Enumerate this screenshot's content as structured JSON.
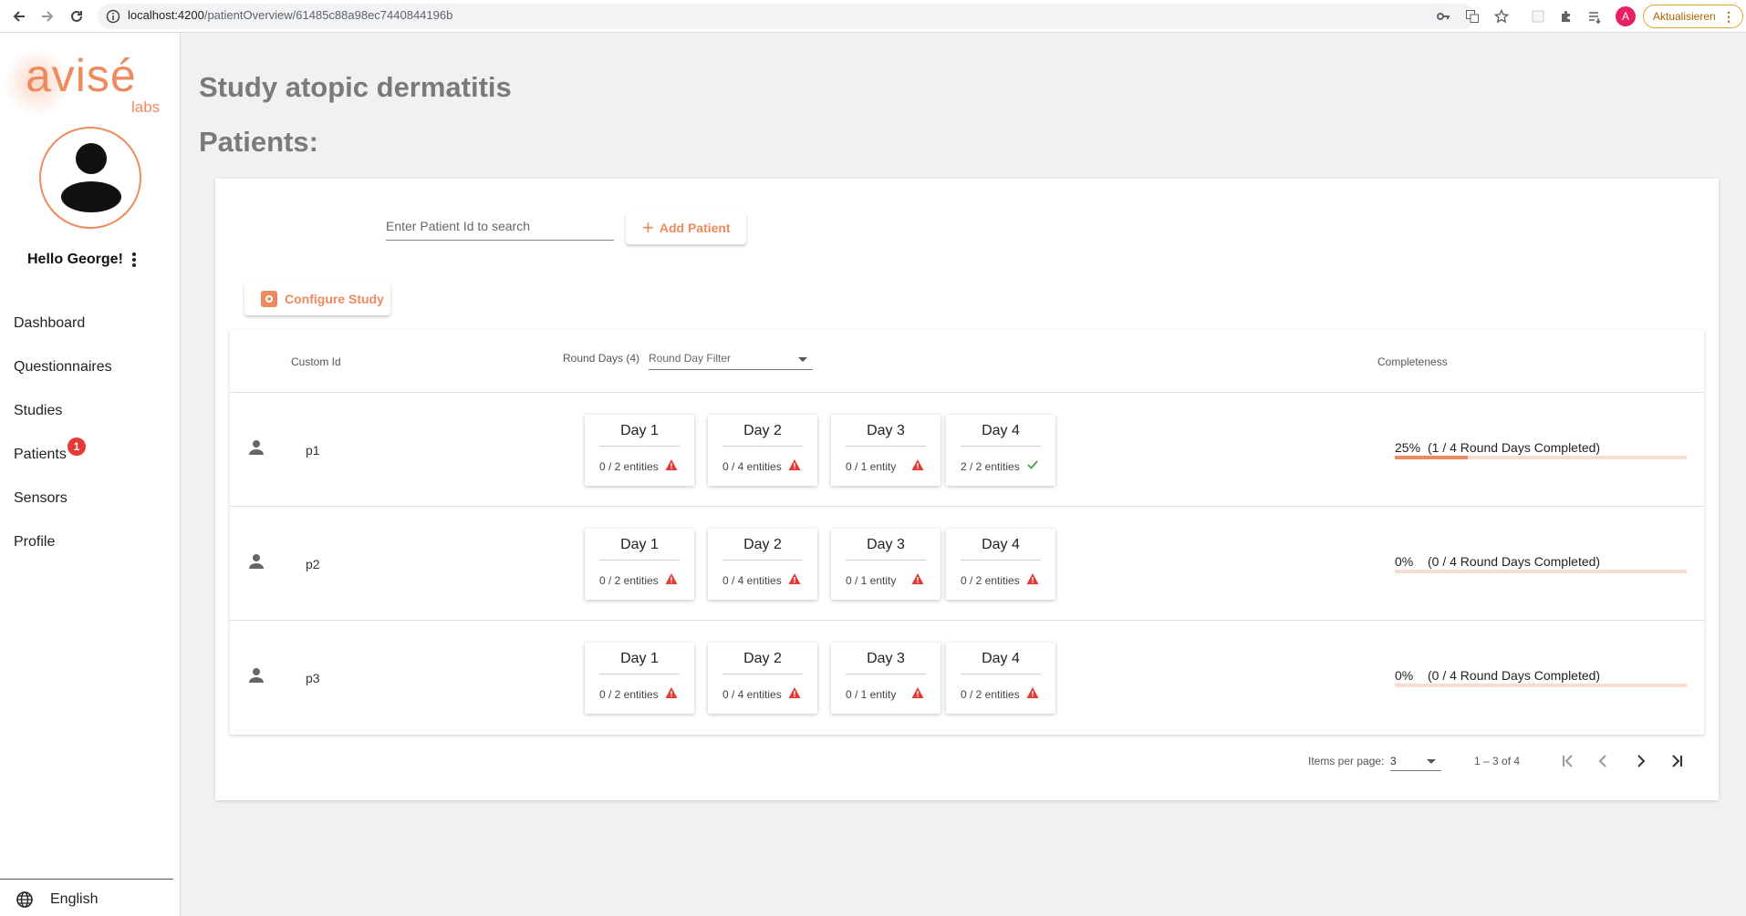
{
  "browser": {
    "url_host": "localhost:4200",
    "url_path": "/patientOverview/61485c88a98ec7440844196b",
    "account_initial": "A",
    "update_label": "Aktualisieren"
  },
  "sidebar": {
    "logo_text": "avisé",
    "logo_sub": "labs",
    "greeting": "Hello George!",
    "nav": [
      {
        "label": "Dashboard"
      },
      {
        "label": "Questionnaires"
      },
      {
        "label": "Studies"
      },
      {
        "label": "Patients",
        "badge": "1"
      },
      {
        "label": "Sensors"
      },
      {
        "label": "Profile"
      }
    ],
    "language": "English"
  },
  "main": {
    "title": "Study atopic dermatitis",
    "section_title": "Patients:",
    "search_placeholder": "Enter Patient Id to search",
    "add_patient_label": "Add Patient",
    "configure_label": "Configure Study",
    "table": {
      "col_custom_id": "Custom Id",
      "col_round_days": "Round Days (4)",
      "filter_placeholder": "Round Day Filter",
      "col_completeness": "Completeness",
      "rows": [
        {
          "id": "p1",
          "days": [
            {
              "title": "Day 1",
              "count": "0 / 2 entities",
              "status": "warning"
            },
            {
              "title": "Day 2",
              "count": "0 / 4 entities",
              "status": "warning"
            },
            {
              "title": "Day 3",
              "count": "0 / 1 entity",
              "status": "warning"
            },
            {
              "title": "Day 4",
              "count": "2 / 2 entities",
              "status": "complete"
            }
          ],
          "percent": "25%",
          "completed_text": "(1 / 4 Round Days Completed)",
          "progress": 0.25
        },
        {
          "id": "p2",
          "days": [
            {
              "title": "Day 1",
              "count": "0 / 2 entities",
              "status": "warning"
            },
            {
              "title": "Day 2",
              "count": "0 / 4 entities",
              "status": "warning"
            },
            {
              "title": "Day 3",
              "count": "0 / 1 entity",
              "status": "warning"
            },
            {
              "title": "Day 4",
              "count": "0 / 2 entities",
              "status": "warning"
            }
          ],
          "percent": "0%",
          "completed_text": "(0 / 4 Round Days Completed)",
          "progress": 0
        },
        {
          "id": "p3",
          "days": [
            {
              "title": "Day 1",
              "count": "0 / 2 entities",
              "status": "warning"
            },
            {
              "title": "Day 2",
              "count": "0 / 4 entities",
              "status": "warning"
            },
            {
              "title": "Day 3",
              "count": "0 / 1 entity",
              "status": "warning"
            },
            {
              "title": "Day 4",
              "count": "0 / 2 entities",
              "status": "warning"
            }
          ],
          "percent": "0%",
          "completed_text": "(0 / 4 Round Days Completed)",
          "progress": 0
        }
      ]
    },
    "paginator": {
      "label": "Items per page:",
      "page_size": "3",
      "range": "1 – 3 of 4"
    }
  },
  "colors": {
    "accent": "#ee8a5d",
    "warning": "#e53935",
    "success": "#43a047"
  }
}
